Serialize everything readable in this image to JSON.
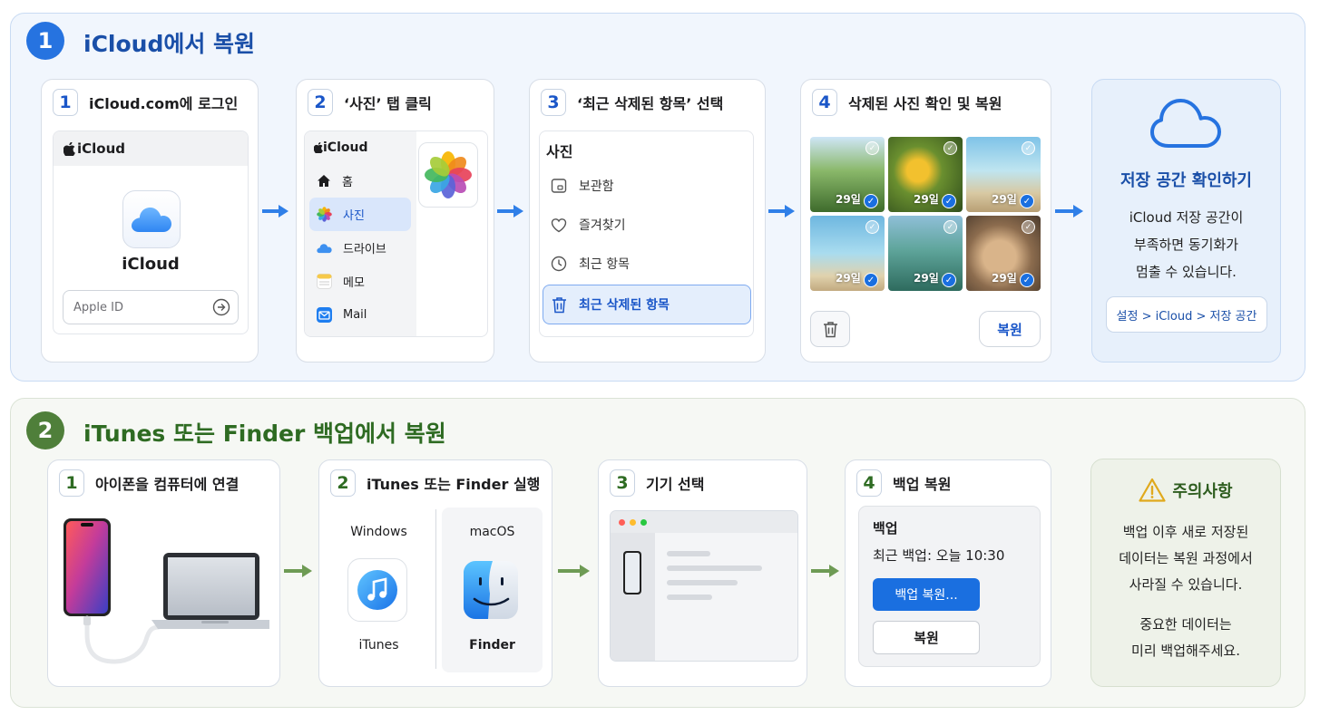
{
  "colors": {
    "blue_accent": "#1a6fe0",
    "blue_title": "#1a4fa8",
    "green_accent": "#5d8a47",
    "green_title": "#2e6b22"
  },
  "section1": {
    "badge": "1",
    "title": "iCloud에서 복원",
    "cards": [
      {
        "num": "1",
        "title": "iCloud.com에 로그인",
        "brand": "iCloud",
        "app_name": "iCloud",
        "input_placeholder": "Apple ID"
      },
      {
        "num": "2",
        "title": "‘사진’ 탭 클릭",
        "brand": "iCloud",
        "sidebar": [
          {
            "label": "홈",
            "icon": "home-icon"
          },
          {
            "label": "사진",
            "icon": "photos-icon",
            "active": true
          },
          {
            "label": "드라이브",
            "icon": "drive-icon"
          },
          {
            "label": "메모",
            "icon": "notes-icon"
          },
          {
            "label": "Mail",
            "icon": "mail-icon"
          }
        ]
      },
      {
        "num": "3",
        "title": "‘최근 삭제된 항목’ 선택",
        "list_title": "사진",
        "items": [
          {
            "label": "보관함",
            "icon": "library-icon"
          },
          {
            "label": "즐겨찾기",
            "icon": "heart-icon"
          },
          {
            "label": "최근 항목",
            "icon": "clock-icon"
          },
          {
            "label": "최근 삭제된 항목",
            "icon": "trash-icon",
            "selected": true
          }
        ]
      },
      {
        "num": "4",
        "title": "삭제된 사진 확인 및 복원",
        "photo_label": "29일",
        "photo_count": 6,
        "restore_label": "복원"
      }
    ],
    "info": {
      "title": "저장 공간 확인하기",
      "line1": "iCloud 저장 공간이",
      "line2": "부족하면 동기화가",
      "line3": "멈출 수 있습니다.",
      "path": "설정 > iCloud > 저장 공간"
    }
  },
  "section2": {
    "badge": "2",
    "title": "iTunes 또는 Finder 백업에서 복원",
    "cards": [
      {
        "num": "1",
        "title": "아이폰을 컴퓨터에 연결"
      },
      {
        "num": "2",
        "title": "iTunes 또는 Finder 실행",
        "windows": {
          "os": "Windows",
          "app": "iTunes"
        },
        "mac": {
          "os": "macOS",
          "app": "Finder"
        }
      },
      {
        "num": "3",
        "title": "기기 선택"
      },
      {
        "num": "4",
        "title": "백업 복원",
        "box_title": "백업",
        "last_backup": "최근 백업: 오늘 10:30",
        "primary_button": "백업 복원...",
        "secondary_button": "복원"
      }
    ],
    "info": {
      "title": "주의사항",
      "line1": "백업 이후 새로 저장된",
      "line2": "데이터는 복원 과정에서",
      "line3": "사라질 수 있습니다.",
      "line4": "중요한 데이터는",
      "line5": "미리 백업해주세요."
    }
  }
}
